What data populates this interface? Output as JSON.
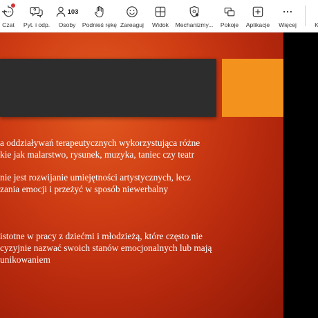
{
  "toolbar": {
    "items": [
      {
        "label": "Czat",
        "icon": "chat-icon"
      },
      {
        "label": "Pyt. i odp.",
        "icon": "qa-icon"
      },
      {
        "label": "Osoby",
        "icon": "people-icon",
        "count": "103"
      },
      {
        "label": "Podnieś rękę",
        "icon": "raise-hand-icon"
      },
      {
        "label": "Zareaguj",
        "icon": "react-icon"
      },
      {
        "label": "Widok",
        "icon": "view-icon"
      },
      {
        "label": "Mechanizmy...",
        "icon": "mechanisms-icon"
      },
      {
        "label": "Pokoje",
        "icon": "rooms-icon"
      },
      {
        "label": "Aplikacje",
        "icon": "apps-icon"
      },
      {
        "label": "Więcej",
        "icon": "more-icon"
      }
    ],
    "partial_label": "K"
  },
  "slide": {
    "paragraphs": [
      [
        "a oddziaływań terapeutycznych wykorzystująca różne",
        "kie jak malarstwo, rysunek, muzyka, taniec czy teatr"
      ],
      [
        "nie jest rozwijanie umiejętności artystycznych, lecz",
        "zania emocji i przeżyć w sposób niewerbalny"
      ],
      [
        "istotne w pracy z dziećmi i młodzieżą, które często nie",
        "cyzyjnie nazwać swoich stanów emocjonalnych lub mają",
        "unikowaniem"
      ]
    ],
    "colors": {
      "title_bar": "#2d2d2d",
      "accent": "#f4921e",
      "background": "#cf3d14"
    }
  }
}
